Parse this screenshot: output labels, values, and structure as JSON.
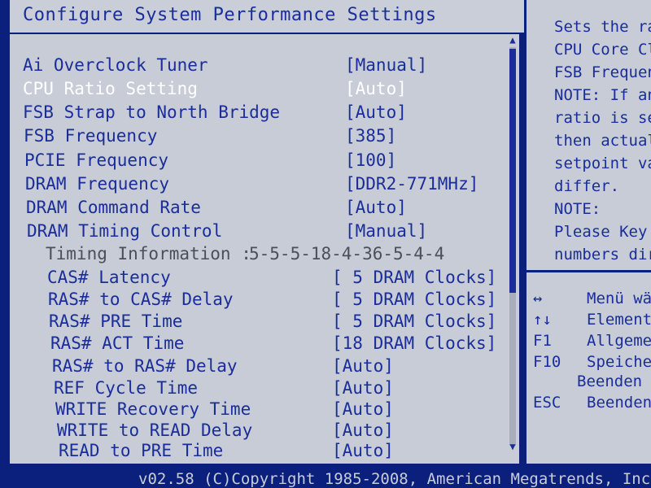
{
  "header": {
    "title": "Configure System Performance Settings"
  },
  "settings": [
    {
      "label": "Ai Overclock Tuner",
      "value": "[Manual]"
    },
    {
      "label": "CPU Ratio Setting",
      "value": "[Auto]",
      "selected": true
    },
    {
      "label": "FSB Strap to North Bridge",
      "value": "[Auto]"
    },
    {
      "label": "FSB Frequency",
      "value": "[385]"
    },
    {
      "label": "PCIE Frequency",
      "value": "[100]"
    },
    {
      "label": "DRAM Frequency",
      "value": "[DDR2-771MHz]"
    },
    {
      "label": "DRAM Command Rate",
      "value": "[Auto]"
    },
    {
      "label": "DRAM Timing Control",
      "value": "[Manual]"
    }
  ],
  "timing_info": {
    "label": "Timing Information :",
    "value": "5-5-5-18-4-36-5-4-4"
  },
  "timings": [
    {
      "label": "CAS# Latency",
      "value": "[ 5 DRAM Clocks]"
    },
    {
      "label": "RAS# to CAS# Delay",
      "value": "[ 5 DRAM Clocks]"
    },
    {
      "label": "RAS# PRE Time",
      "value": "[ 5 DRAM Clocks]"
    },
    {
      "label": "RAS# ACT Time",
      "value": "[18 DRAM Clocks]"
    },
    {
      "label": "RAS# to RAS# Delay",
      "value": "[Auto]"
    },
    {
      "label": "REF Cycle Time",
      "value": "[Auto]"
    },
    {
      "label": "WRITE Recovery Time",
      "value": "[Auto]"
    },
    {
      "label": "WRITE to READ Delay",
      "value": "[Auto]"
    },
    {
      "label": "READ to PRE Time",
      "value": "[Auto]"
    }
  ],
  "help": {
    "lines": [
      "Sets the ra",
      "CPU Core Cl",
      "FSB Frequen",
      "NOTE: If an",
      "ratio is se",
      "then actual",
      "setpoint va",
      "differ.",
      "NOTE:",
      "Please Key i",
      "numbers dire"
    ],
    "keys": [
      {
        "key": "↔",
        "desc": "Menü wä"
      },
      {
        "key": "↑↓",
        "desc": "Element"
      },
      {
        "key": "F1",
        "desc": "Allgemei"
      },
      {
        "key": "F10",
        "desc": "Speicher"
      },
      {
        "key": "",
        "desc": "Beenden"
      },
      {
        "key": "ESC",
        "desc": "Beenden"
      }
    ]
  },
  "footer": {
    "text": "v02.58 (C)Copyright 1985-2008, American Megatrends, Inc."
  },
  "scroll": {
    "up_glyph": "▲",
    "down_glyph": "▼",
    "position": 0.0
  },
  "colors": {
    "background": "#0b1f7c",
    "panel": "#c7ccd6",
    "text": "#1a2d9a",
    "selected": "#ffffff"
  }
}
